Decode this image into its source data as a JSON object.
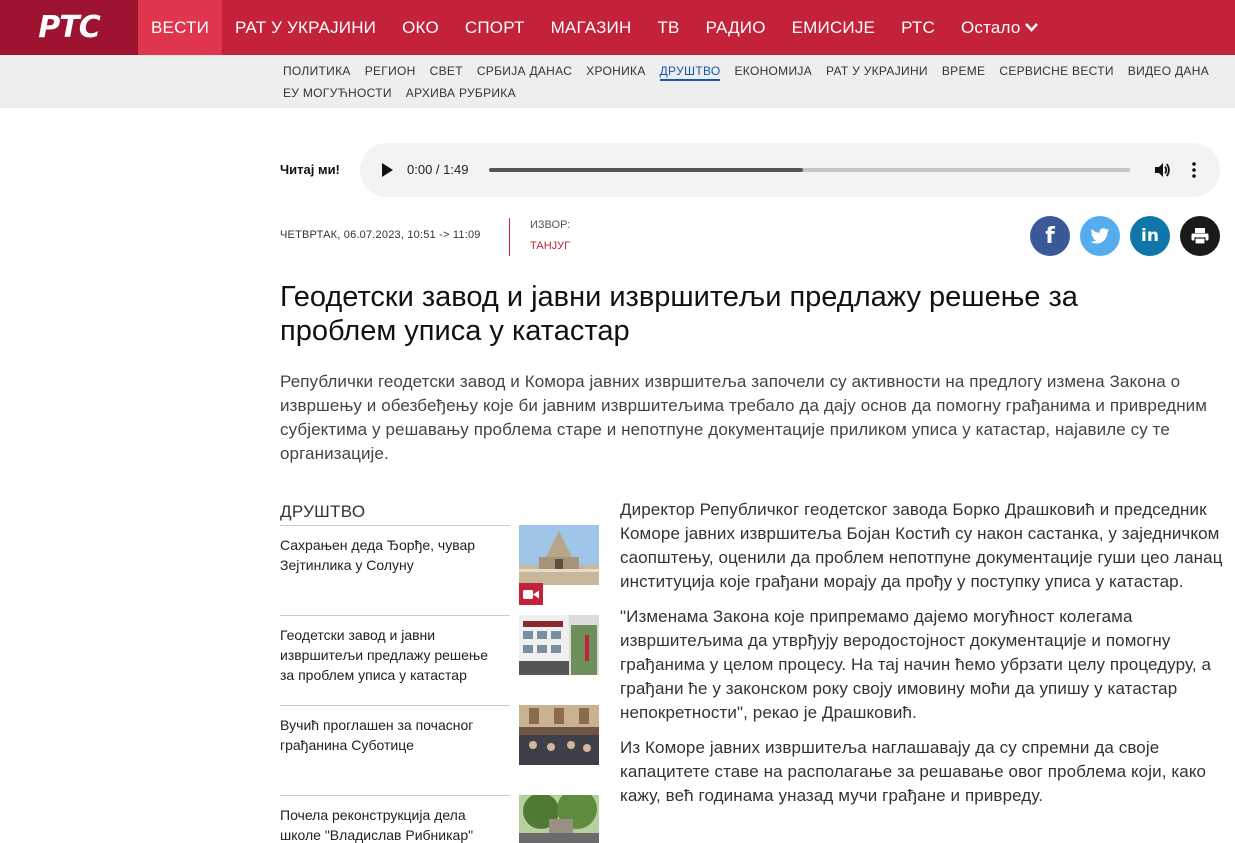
{
  "header": {
    "logo": "РТС",
    "nav": [
      {
        "label": "ВЕСТИ",
        "active": true
      },
      {
        "label": "РАТ У УКРАЈИНИ"
      },
      {
        "label": "ОКО"
      },
      {
        "label": "СПОРТ"
      },
      {
        "label": "МАГАЗИН"
      },
      {
        "label": "ТВ"
      },
      {
        "label": "РАДИО"
      },
      {
        "label": "ЕМИСИЈЕ"
      },
      {
        "label": "РТС"
      },
      {
        "label": "Остало"
      }
    ],
    "more_icon": "chevron-down-icon",
    "colors": {
      "bar": "#c4213a",
      "logo_bg": "#9e1430",
      "active": "#e0364d"
    }
  },
  "subnav": {
    "row1": [
      "ПОЛИТИКА",
      "РЕГИОН",
      "СВЕТ",
      "СРБИЈА ДАНАС",
      "ХРОНИКА",
      "ДРУШТВО",
      "ЕКОНОМИЈА",
      "РАТ У УКРАЈИНИ",
      "ВРЕМЕ",
      "СЕРВИСНЕ ВЕСТИ",
      "ВИДЕО ДАНА"
    ],
    "row2": [
      "ЕУ МОГУЋНОСТИ",
      "АРХИВА РУБРИКА"
    ],
    "active": "ДРУШТВО",
    "active_color": "#1a56b0"
  },
  "audio": {
    "read_label": "Читај ми!",
    "time": "0:00 / 1:49",
    "progress_fraction": 0.49,
    "icons": [
      "play-icon",
      "volume-icon",
      "more-options-icon"
    ]
  },
  "meta": {
    "date": "ЧЕТВРТАК, 06.07.2023,  10:51 -> 11:09",
    "source_label": "ИЗВОР:",
    "source": "ТАНЈУГ",
    "share_icons": [
      "facebook-icon",
      "twitter-icon",
      "linkedin-icon",
      "print-icon"
    ]
  },
  "article": {
    "title": "Геодетски завод и јавни извршитељи предлажу решење за проблем уписа у катастар",
    "lead": "Републички геодетски завод и Комора јавних извршитеља започели су активности на предлогу измена Закона о извршењу и обезбеђењу које би јавним извршитељима требало да дају основ да помогну грађанима и привредним субјектима у решавању проблема старе и непотпуне документације приликом уписа у катастар, најавиле су те организације.",
    "paragraphs": [
      "Директор Републичког геодетског завода Борко Драшковић и председник Коморе јавних извршитеља Бојан Костић су након састанка, у заједничком саопштењу, оценили да проблем непотпуне документације гуши цео ланац институција које грађани морају да прођу у поступку уписа у катастар.",
      "\"Изменама Закона које припремамо дајемо могућност колегама извршитељима да утврђују веродостојност документације и помогну грађанима у целом процесу. На тај начин ћемо убрзати целу процедуру, а грађани ће у законском року своју имовину моћи да упишу у катастар непокретности\", рекао је Драшковић.",
      "Из Коморе јавних извршитеља наглашавају да су спремни да своје капацитете ставе на располагање за решавање овог проблема који, како кажу, већ годинама уназад мучи грађане и привреду."
    ]
  },
  "sidebar": {
    "heading": "ДРУШТВО",
    "items": [
      {
        "text": "Сахрањен деда Ђорђе, чувар Зејтинлика у Солуну",
        "video": true
      },
      {
        "text": "Геодетски завод и јавни извршитељи предлажу решење за проблем уписа у катастар"
      },
      {
        "text": "Вучић проглашен за почасног грађанина Суботице"
      },
      {
        "text": "Почела реконструкција дела школе \"Владислав Рибникар\""
      }
    ]
  }
}
